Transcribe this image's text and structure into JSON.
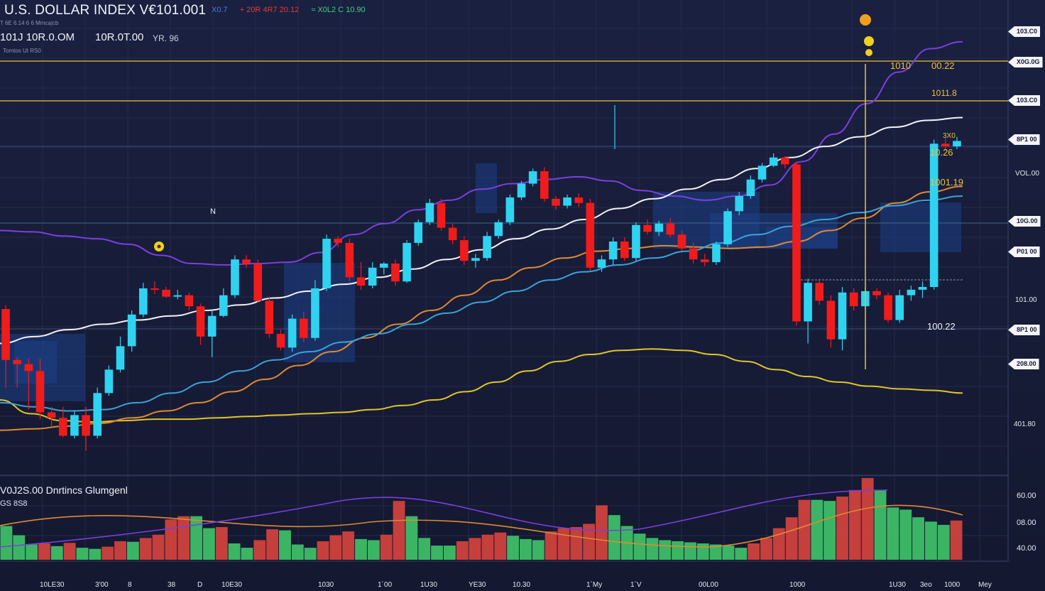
{
  "header": {
    "title": "U.S. DOLLAR INDEX V€101.001",
    "stats": [
      {
        "text": "X0.7",
        "color": "#4a7bd8"
      },
      {
        "text": "+ 20R 4R7 20.12",
        "color": "#e23b3b"
      },
      {
        "text": "≈ X0L2 C 10.90",
        "color": "#3fcf8e"
      }
    ],
    "line2_a": "101J 10R.0.OM",
    "line2_b": "10R.0T.00",
    "line2_c": "YR. 96",
    "tiny_a": "T 6E 6.14 6 6 Mmca|cb",
    "tiny_b": "Tomtos Ut RS0"
  },
  "price_axis_labels": [
    "103.C0",
    "X0G.0G",
    "103.C0",
    "8P1 00",
    "VOL.00",
    "10G.00",
    "P01 00",
    "101.00",
    "8P1 00",
    "208.00",
    "401.80"
  ],
  "price_line_labels": [
    {
      "text": "1010",
      "color": "#f0c23a"
    },
    {
      "text": "00.22",
      "color": "#f0c23a"
    },
    {
      "text": "1011.8",
      "color": "#f0c23a"
    },
    {
      "text": "3X0",
      "color": "#f0c23a"
    },
    {
      "text": "10.26",
      "color": "#f0c23a"
    },
    {
      "text": "1001.19",
      "color": "#f0c23a"
    },
    {
      "text": "100.22",
      "color": "#f0f2f8"
    },
    {
      "text": "N",
      "color": "#f0f2f8"
    }
  ],
  "volume_panel": {
    "title": "V0J2S.00 Dnrtincs Glumgenl",
    "subtitle": "GS 8S8",
    "axis_labels": [
      "60.00",
      "08.00",
      "40.00"
    ]
  },
  "x_axis_labels": [
    "10LE30",
    "3'00",
    "8",
    "38",
    "D",
    "10E30",
    "1030",
    "1´00",
    "1U30",
    "YE30",
    "10.30",
    "1´My",
    "1´V",
    "00L00",
    "1000",
    "1U30",
    "3eo",
    "1000",
    "Mey"
  ],
  "colors": {
    "background": "#151a33",
    "up_candle": "#2fd3f0",
    "down_candle": "#f01c1c",
    "ma_yellow": "#e0c42a",
    "ma_orange": "#e08a30",
    "ma_purple": "#7b3fe0",
    "ma_white": "#f2f2f5",
    "ma_blue": "#3aa3d8",
    "vol_up": "#3fc66a",
    "vol_down": "#d8443e",
    "hline": "#c9a63a"
  },
  "chart_data": {
    "type": "candlestick",
    "title": "U.S. DOLLAR INDEX V€101.001",
    "candles": [
      {
        "o": 101.32,
        "h": 101.38,
        "l": 100.18,
        "c": 100.58
      },
      {
        "o": 100.58,
        "h": 100.62,
        "l": 100.18,
        "c": 100.52
      },
      {
        "o": 100.52,
        "h": 100.6,
        "l": 99.86,
        "c": 100.42
      },
      {
        "o": 100.42,
        "h": 100.6,
        "l": 99.72,
        "c": 99.82
      },
      {
        "o": 99.82,
        "h": 99.9,
        "l": 99.62,
        "c": 99.74
      },
      {
        "o": 99.74,
        "h": 99.9,
        "l": 99.46,
        "c": 99.48
      },
      {
        "o": 99.48,
        "h": 99.84,
        "l": 99.44,
        "c": 99.78
      },
      {
        "o": 99.78,
        "h": 99.9,
        "l": 99.26,
        "c": 99.48
      },
      {
        "o": 99.48,
        "h": 100.18,
        "l": 99.44,
        "c": 100.1
      },
      {
        "o": 100.1,
        "h": 100.5,
        "l": 100.06,
        "c": 100.44
      },
      {
        "o": 100.44,
        "h": 100.92,
        "l": 100.4,
        "c": 100.78
      },
      {
        "o": 100.78,
        "h": 101.3,
        "l": 100.7,
        "c": 101.24
      },
      {
        "o": 101.24,
        "h": 101.7,
        "l": 101.2,
        "c": 101.62
      },
      {
        "o": 101.62,
        "h": 101.72,
        "l": 101.54,
        "c": 101.6
      },
      {
        "o": 101.6,
        "h": 101.64,
        "l": 101.48,
        "c": 101.5
      },
      {
        "o": 101.5,
        "h": 101.6,
        "l": 101.46,
        "c": 101.52
      },
      {
        "o": 101.52,
        "h": 101.56,
        "l": 101.3,
        "c": 101.36
      },
      {
        "o": 101.36,
        "h": 101.4,
        "l": 100.8,
        "c": 100.92
      },
      {
        "o": 100.92,
        "h": 101.3,
        "l": 100.62,
        "c": 101.22
      },
      {
        "o": 101.22,
        "h": 101.62,
        "l": 101.2,
        "c": 101.52
      },
      {
        "o": 101.52,
        "h": 102.1,
        "l": 101.48,
        "c": 102.04
      },
      {
        "o": 102.04,
        "h": 102.1,
        "l": 101.92,
        "c": 101.98
      },
      {
        "o": 101.98,
        "h": 102.04,
        "l": 101.42,
        "c": 101.44
      },
      {
        "o": 101.44,
        "h": 101.5,
        "l": 100.9,
        "c": 100.96
      },
      {
        "o": 100.96,
        "h": 101.02,
        "l": 100.72,
        "c": 100.76
      },
      {
        "o": 100.76,
        "h": 101.24,
        "l": 100.7,
        "c": 101.18
      },
      {
        "o": 101.18,
        "h": 101.28,
        "l": 100.84,
        "c": 100.9
      },
      {
        "o": 100.9,
        "h": 101.74,
        "l": 100.86,
        "c": 101.62
      },
      {
        "o": 101.62,
        "h": 102.4,
        "l": 101.58,
        "c": 102.34
      },
      {
        "o": 102.34,
        "h": 102.38,
        "l": 102.22,
        "c": 102.28
      },
      {
        "o": 102.28,
        "h": 102.34,
        "l": 101.72,
        "c": 101.78
      },
      {
        "o": 101.78,
        "h": 102.0,
        "l": 101.6,
        "c": 101.66
      },
      {
        "o": 101.66,
        "h": 102.0,
        "l": 101.62,
        "c": 101.92
      },
      {
        "o": 101.92,
        "h": 102.0,
        "l": 101.82,
        "c": 101.98
      },
      {
        "o": 101.98,
        "h": 102.04,
        "l": 101.66,
        "c": 101.72
      },
      {
        "o": 101.72,
        "h": 102.32,
        "l": 101.7,
        "c": 102.28
      },
      {
        "o": 102.28,
        "h": 102.62,
        "l": 102.24,
        "c": 102.58
      },
      {
        "o": 102.58,
        "h": 102.92,
        "l": 102.54,
        "c": 102.86
      },
      {
        "o": 102.86,
        "h": 102.92,
        "l": 102.46,
        "c": 102.5
      },
      {
        "o": 102.5,
        "h": 102.56,
        "l": 102.26,
        "c": 102.32
      },
      {
        "o": 102.32,
        "h": 102.38,
        "l": 101.96,
        "c": 102.02
      },
      {
        "o": 102.02,
        "h": 102.12,
        "l": 101.92,
        "c": 102.06
      },
      {
        "o": 102.06,
        "h": 102.44,
        "l": 102.02,
        "c": 102.38
      },
      {
        "o": 102.38,
        "h": 102.62,
        "l": 102.34,
        "c": 102.58
      },
      {
        "o": 102.58,
        "h": 102.98,
        "l": 102.54,
        "c": 102.94
      },
      {
        "o": 102.94,
        "h": 103.18,
        "l": 102.9,
        "c": 103.14
      },
      {
        "o": 103.14,
        "h": 103.36,
        "l": 103.1,
        "c": 103.32
      },
      {
        "o": 103.32,
        "h": 103.38,
        "l": 102.88,
        "c": 102.92
      },
      {
        "o": 102.92,
        "h": 102.96,
        "l": 102.76,
        "c": 102.82
      },
      {
        "o": 102.82,
        "h": 102.98,
        "l": 102.78,
        "c": 102.94
      },
      {
        "o": 102.94,
        "h": 103.0,
        "l": 102.8,
        "c": 102.86
      },
      {
        "o": 102.86,
        "h": 102.92,
        "l": 101.88,
        "c": 101.92
      },
      {
        "o": 101.92,
        "h": 102.1,
        "l": 101.86,
        "c": 102.04
      },
      {
        "o": 102.04,
        "h": 102.36,
        "l": 101.96,
        "c": 102.3
      },
      {
        "o": 102.3,
        "h": 102.36,
        "l": 102.02,
        "c": 102.06
      },
      {
        "o": 102.06,
        "h": 102.58,
        "l": 102.02,
        "c": 102.54
      },
      {
        "o": 102.54,
        "h": 102.62,
        "l": 102.4,
        "c": 102.44
      },
      {
        "o": 102.44,
        "h": 102.6,
        "l": 102.38,
        "c": 102.56
      },
      {
        "o": 102.56,
        "h": 102.64,
        "l": 102.36,
        "c": 102.4
      },
      {
        "o": 102.4,
        "h": 102.46,
        "l": 102.16,
        "c": 102.2
      },
      {
        "o": 102.2,
        "h": 102.28,
        "l": 101.98,
        "c": 102.04
      },
      {
        "o": 102.04,
        "h": 102.12,
        "l": 101.94,
        "c": 102.0
      },
      {
        "o": 102.0,
        "h": 102.3,
        "l": 101.96,
        "c": 102.26
      },
      {
        "o": 102.26,
        "h": 102.78,
        "l": 102.22,
        "c": 102.74
      },
      {
        "o": 102.74,
        "h": 103.02,
        "l": 102.68,
        "c": 102.96
      },
      {
        "o": 102.96,
        "h": 103.26,
        "l": 102.92,
        "c": 103.2
      },
      {
        "o": 103.2,
        "h": 103.44,
        "l": 103.16,
        "c": 103.4
      },
      {
        "o": 103.4,
        "h": 103.58,
        "l": 103.38,
        "c": 103.52
      },
      {
        "o": 103.52,
        "h": 103.54,
        "l": 103.36,
        "c": 103.42
      },
      {
        "o": 103.42,
        "h": 103.46,
        "l": 101.08,
        "c": 101.14
      },
      {
        "o": 101.14,
        "h": 101.76,
        "l": 100.82,
        "c": 101.7
      },
      {
        "o": 101.7,
        "h": 101.76,
        "l": 101.38,
        "c": 101.44
      },
      {
        "o": 101.44,
        "h": 101.52,
        "l": 100.76,
        "c": 100.88
      },
      {
        "o": 100.88,
        "h": 101.64,
        "l": 100.72,
        "c": 101.56
      },
      {
        "o": 101.56,
        "h": 101.62,
        "l": 101.3,
        "c": 101.36
      },
      {
        "o": 101.36,
        "h": 101.62,
        "l": 101.32,
        "c": 101.58
      },
      {
        "o": 101.58,
        "h": 101.62,
        "l": 101.46,
        "c": 101.52
      },
      {
        "o": 101.52,
        "h": 101.56,
        "l": 101.12,
        "c": 101.16
      },
      {
        "o": 101.16,
        "h": 101.6,
        "l": 101.12,
        "c": 101.52
      },
      {
        "o": 101.52,
        "h": 101.66,
        "l": 101.44,
        "c": 101.6
      },
      {
        "o": 101.6,
        "h": 101.72,
        "l": 101.48,
        "c": 101.64
      },
      {
        "o": 101.64,
        "h": 103.78,
        "l": 101.6,
        "c": 103.72
      },
      {
        "o": 103.72,
        "h": 103.8,
        "l": 103.62,
        "c": 103.68
      },
      {
        "o": 103.68,
        "h": 103.82,
        "l": 103.64,
        "c": 103.76
      }
    ],
    "volume": [
      62,
      45,
      28,
      30,
      25,
      31,
      22,
      20,
      24,
      34,
      33,
      40,
      46,
      74,
      80,
      80,
      58,
      60,
      30,
      22,
      36,
      56,
      54,
      28,
      22,
      34,
      45,
      52,
      38,
      36,
      46,
      108,
      80,
      40,
      26,
      26,
      34,
      40,
      46,
      50,
      44,
      38,
      36,
      52,
      58,
      60,
      66,
      100,
      82,
      62,
      48,
      40,
      36,
      34,
      32,
      30,
      28,
      26,
      22,
      30,
      40,
      58,
      78,
      110,
      110,
      108,
      116,
      128,
      150,
      128,
      96,
      92,
      78,
      70,
      64,
      72
    ],
    "moving_averages": [
      {
        "color_key": "ma_yellow",
        "values": [
          100.0,
          99.8,
          99.7,
          99.68,
          99.7,
          99.72,
          99.72,
          99.74,
          99.76,
          99.78,
          99.8,
          99.82,
          99.86,
          99.92,
          100.0,
          100.12,
          100.26,
          100.42,
          100.56,
          100.66,
          100.72,
          100.74,
          100.72,
          100.66,
          100.56,
          100.44,
          100.34,
          100.26,
          100.2,
          100.16,
          100.14,
          100.1
        ]
      },
      {
        "color_key": "ma_orange",
        "values": [
          99.56,
          99.58,
          99.62,
          99.66,
          99.74,
          99.84,
          99.96,
          100.12,
          100.3,
          100.5,
          100.7,
          100.9,
          101.1,
          101.3,
          101.52,
          101.74,
          101.92,
          102.06,
          102.16,
          102.2,
          102.24,
          102.22,
          102.2,
          102.22,
          102.3,
          102.46,
          102.64,
          102.86,
          103.02,
          103.1
        ]
      },
      {
        "color_key": "ma_purple",
        "values": [
          102.46,
          102.44,
          102.38,
          102.34,
          102.26,
          102.1,
          101.98,
          101.96,
          101.98,
          102.0,
          102.14,
          102.4,
          102.56,
          102.76,
          102.9,
          103.06,
          103.14,
          103.2,
          103.24,
          103.18,
          103.04,
          102.96,
          102.9,
          102.96,
          103.12,
          103.46,
          103.86,
          104.3,
          104.76,
          105.1,
          105.2
        ]
      },
      {
        "color_key": "ma_white",
        "values": [
          100.82,
          100.92,
          101.02,
          101.1,
          101.16,
          101.22,
          101.3,
          101.38,
          101.48,
          101.58,
          101.68,
          101.78,
          101.9,
          102.04,
          102.18,
          102.34,
          102.48,
          102.62,
          102.78,
          102.92,
          103.06,
          103.2,
          103.36,
          103.52,
          103.68,
          103.82,
          103.96,
          104.06,
          104.1
        ]
      },
      {
        "color_key": "ma_blue",
        "values": [
          99.96,
          99.9,
          99.84,
          99.86,
          99.96,
          100.1,
          100.26,
          100.42,
          100.58,
          100.7,
          100.84,
          100.96,
          101.1,
          101.26,
          101.42,
          101.58,
          101.74,
          101.86,
          101.96,
          102.06,
          102.16,
          102.28,
          102.4,
          102.52,
          102.62,
          102.72,
          102.82,
          102.9,
          102.96
        ]
      }
    ],
    "ylim": [
      99.0,
      105.6
    ],
    "grid": true
  }
}
